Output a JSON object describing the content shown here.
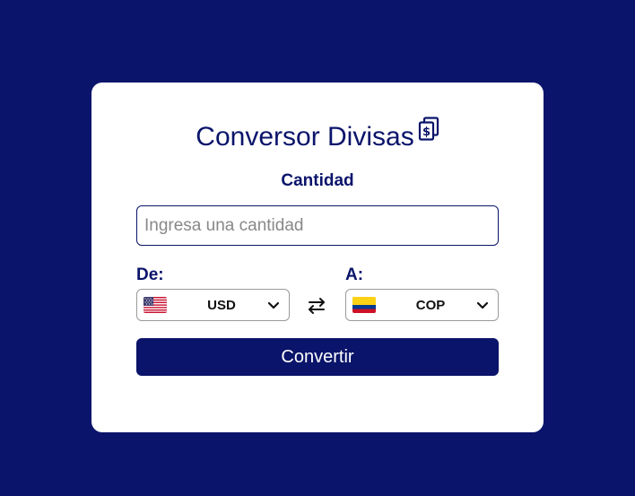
{
  "header": {
    "title": "Conversor Divisas",
    "title_icon": "currency-copy-icon"
  },
  "amount": {
    "label": "Cantidad",
    "placeholder": "Ingresa una cantidad",
    "value": ""
  },
  "from": {
    "label": "De:",
    "code": "USD",
    "flag": "us-flag-icon"
  },
  "to": {
    "label": "A:",
    "code": "COP",
    "flag": "colombia-flag-icon"
  },
  "swap_icon": "swap-arrows-icon",
  "convert_button": {
    "label": "Convertir"
  },
  "colors": {
    "background": "#0a146a",
    "card": "#ffffff",
    "accent": "#0a146a"
  }
}
